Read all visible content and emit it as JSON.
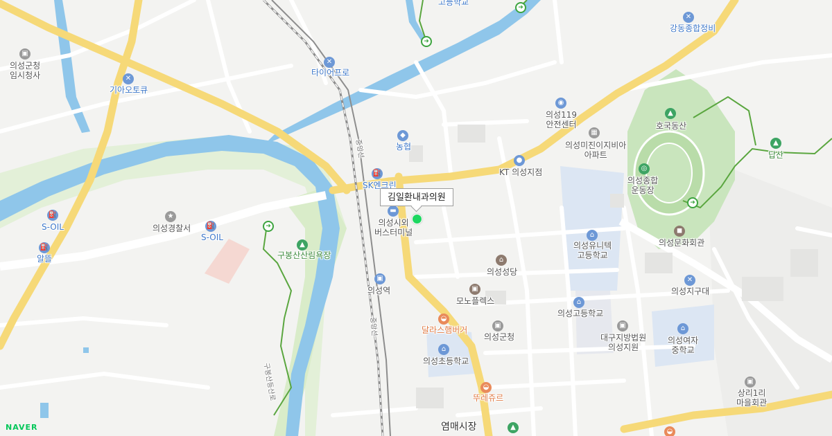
{
  "map": {
    "selected_place": "김일환내과의원",
    "brand": "NAVER",
    "labels": {
      "gosa": "고등학교",
      "gangdong": "강동종합정비",
      "uiseong_office": "의성군청\n임시청사",
      "tire": "타이어프로",
      "kia": "기아오토큐",
      "fire119": "의성119\n안전센터",
      "nonghyup": "농협",
      "hogukdongsan": "호국동산",
      "mijin": "의성미진이지비아\n아파트",
      "dapsan": "답산",
      "kt": "KT 의성지점",
      "sk": "SK엔크린",
      "stadium": "의성종합\n운동장",
      "soil_left": "S-OIL",
      "police": "의성경찰서",
      "soil_mid": "S-OIL",
      "busterminal": "의성시외\n버스터미널",
      "arttalgang": "의성문화회관",
      "unitech": "의성유니텍\n고등학교",
      "altteul": "알뜰",
      "gubongsan": "구봉산산림욕장",
      "cathedral": "의성성당",
      "jigudae": "의성지구대",
      "station": "의성역",
      "moduplex": "모노플렉스",
      "highschool": "의성고등학교",
      "gunhall": "의성군청",
      "court": "대구지방법원\n의성지원",
      "girls_ms": "의성여자\n중학교",
      "dallas": "달라스햄버거",
      "elementary": "의성초등학교",
      "sangri": "상리1리\n마을회관",
      "touresjour": "뚜레쥬르",
      "market": "염매시장",
      "road_jungang": "중앙선",
      "road_jungang2": "중앙선",
      "road_trail": "구봉산등산로"
    }
  }
}
